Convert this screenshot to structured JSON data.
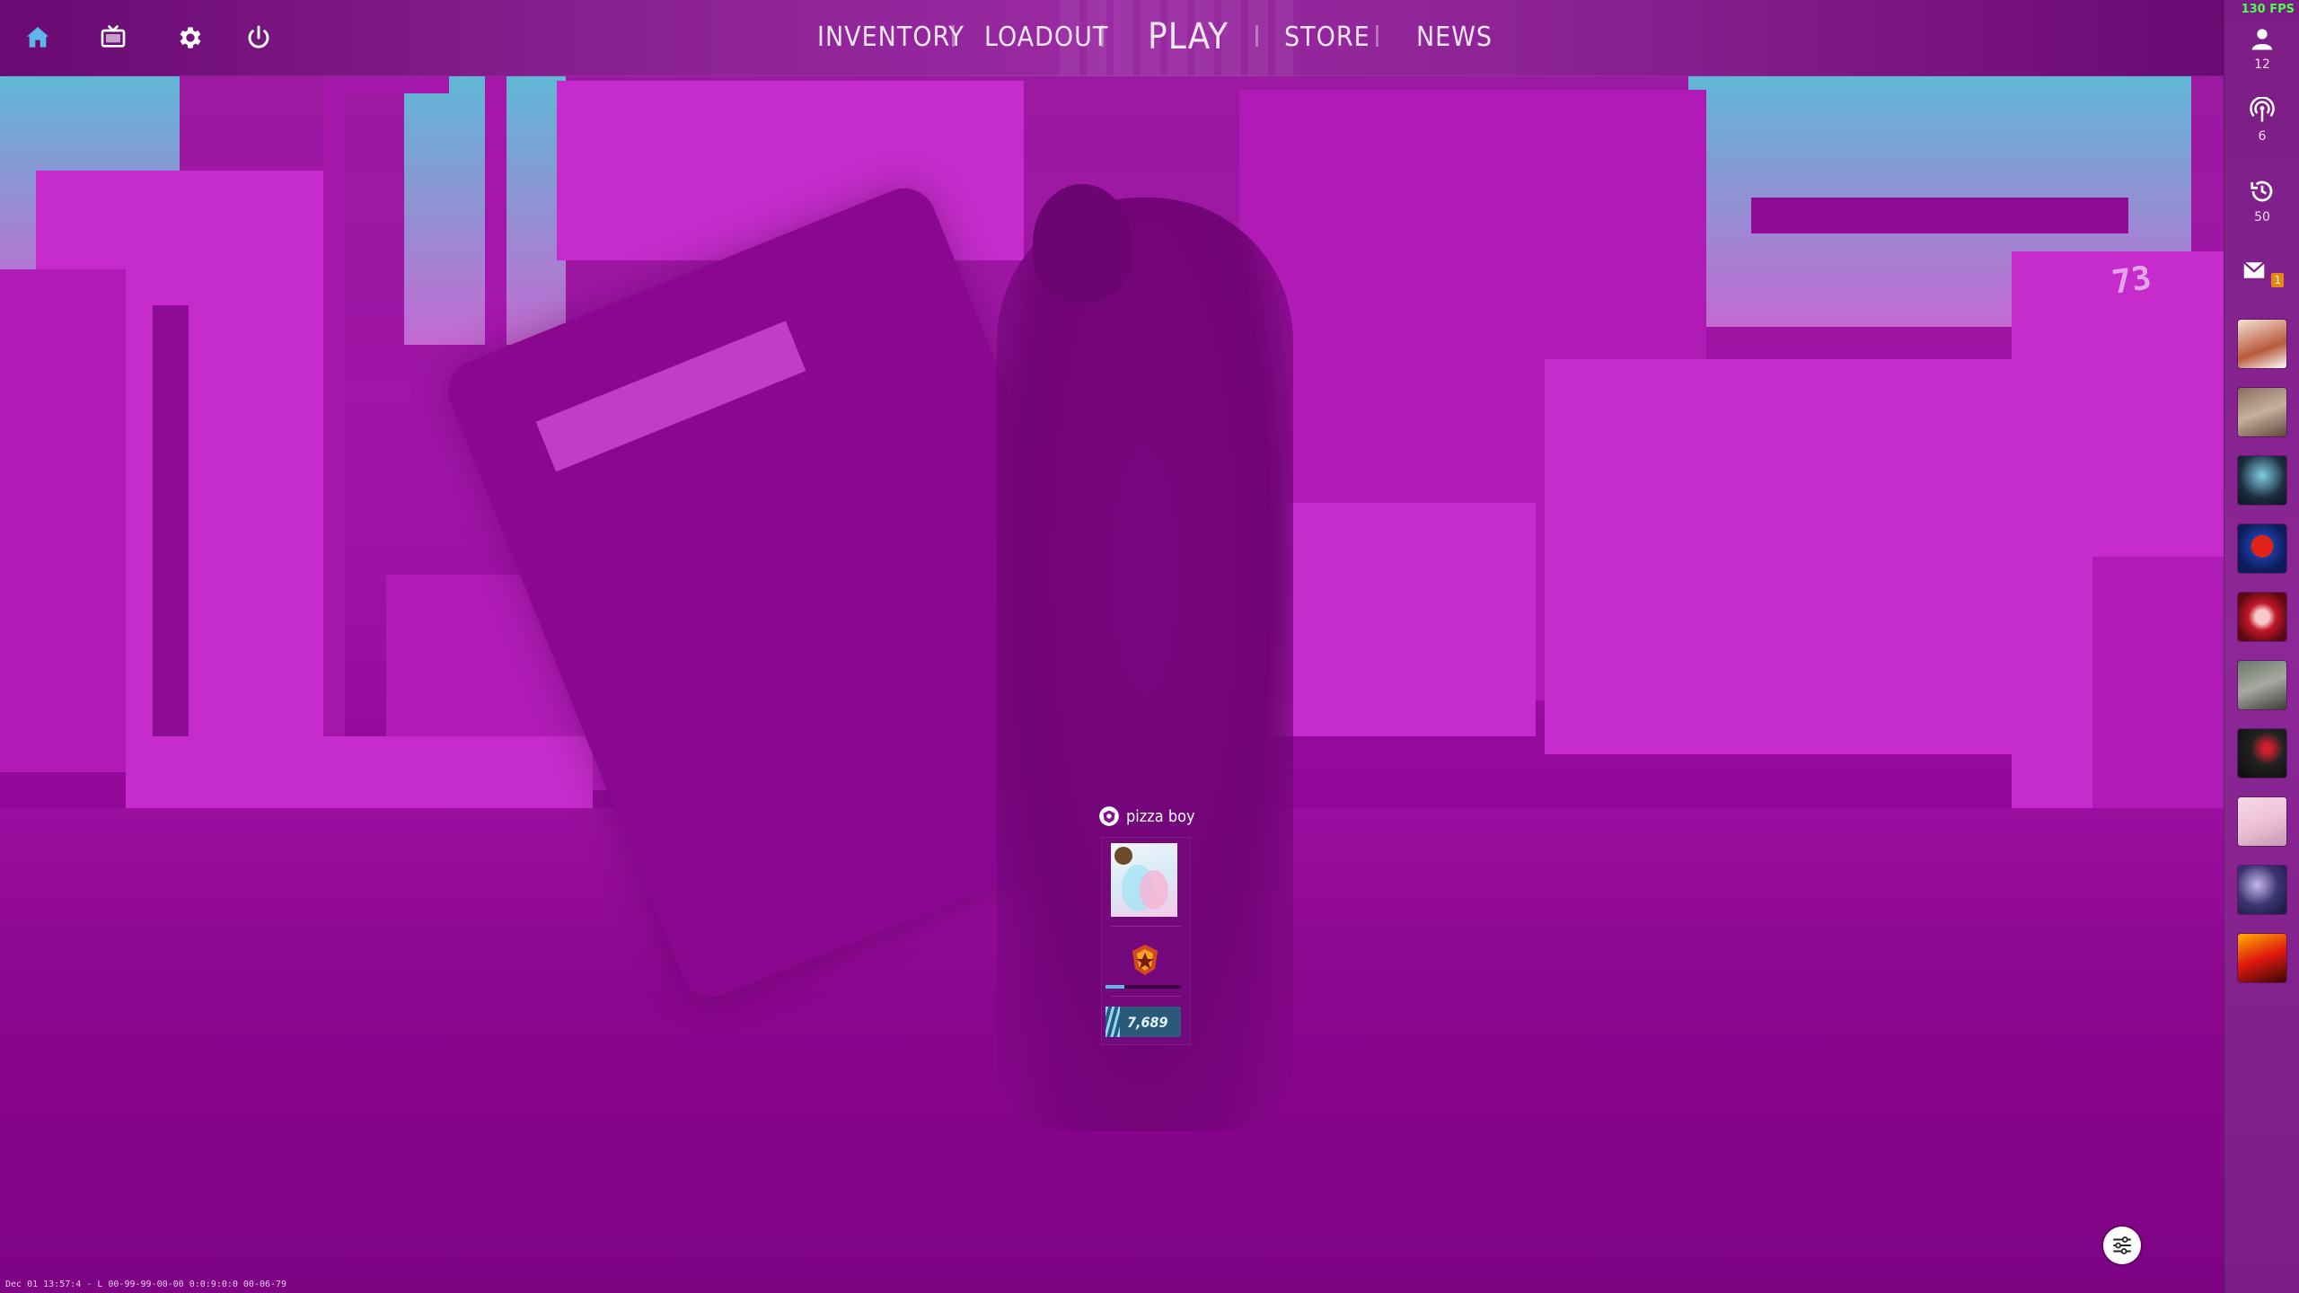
{
  "nav": {
    "items": [
      {
        "label": "INVENTORY"
      },
      {
        "label": "LOADOUT"
      },
      {
        "label": "PLAY"
      },
      {
        "label": "STORE"
      },
      {
        "label": "NEWS"
      }
    ],
    "active": "PLAY"
  },
  "top_icons": [
    "home-icon",
    "tv-icon",
    "gear-icon",
    "power-icon"
  ],
  "sidebar": {
    "fps": "130 FPS",
    "friends_online": "12",
    "broadcast_count": "6",
    "history_count": "50",
    "mail_unread": "1",
    "friend_avatars": 10
  },
  "player": {
    "name": "pizza boy",
    "xp": "7,689",
    "level_progress": 0.25
  },
  "debug_text": "Dec 01 13:57:4 - L 00-99-99-00-00 0:0:9:0:0 00-06-79",
  "colors": {
    "scene_tint": "#9a12a0",
    "accent_blue": "#5bb8e8",
    "fps_green": "#4cff4c",
    "mail_badge": "#e8860e"
  },
  "scene_text": "73"
}
